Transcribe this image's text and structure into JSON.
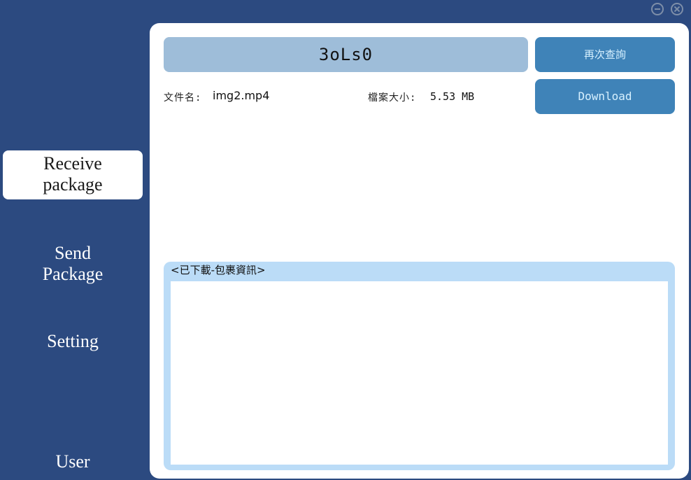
{
  "window": {
    "minimize_icon": "minimize-circle-icon",
    "close_icon": "close-circle-icon"
  },
  "sidebar": {
    "items": [
      {
        "label_line1": "Receive",
        "label_line2": "package",
        "active": true
      },
      {
        "label_line1": "Send",
        "label_line2": "Package",
        "active": false
      },
      {
        "label_line1": "Setting",
        "label_line2": "",
        "active": false
      },
      {
        "label_line1": "User",
        "label_line2": "",
        "active": false
      }
    ]
  },
  "receive": {
    "code": "3oLs0",
    "requery_label": "再次查詢",
    "download_label": "Download",
    "filename_label": "文件名:",
    "filename_value": "img2.mp4",
    "size_label": "檔案大小:",
    "size_value": "5.53 MB"
  },
  "history": {
    "title": "<已下載-包裹資訊>"
  },
  "colors": {
    "background": "#2c4a80",
    "code_box": "#9ebdd9",
    "button": "#3f83b8",
    "button_text": "#d7f1ff",
    "history_frame": "#bbdcf7"
  }
}
